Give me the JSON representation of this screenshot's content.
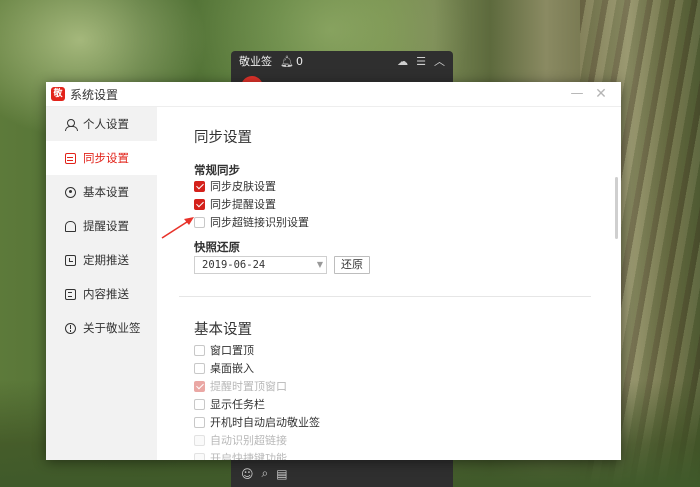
{
  "background_widget": {
    "title": "敬业签",
    "bell_count": "0"
  },
  "dialog": {
    "title": "系统设置",
    "logo_text": "敬",
    "minimize_symbol": "—",
    "close_symbol": "✕"
  },
  "sidebar": {
    "items": [
      {
        "label": "个人设置",
        "icon": "user-icon"
      },
      {
        "label": "同步设置",
        "icon": "sync-icon",
        "active": true
      },
      {
        "label": "基本设置",
        "icon": "gear-icon"
      },
      {
        "label": "提醒设置",
        "icon": "bell-icon"
      },
      {
        "label": "定期推送",
        "icon": "clock-icon"
      },
      {
        "label": "内容推送",
        "icon": "doc-icon"
      },
      {
        "label": "关于敬业签",
        "icon": "info-icon"
      }
    ]
  },
  "sync": {
    "title": "同步设置",
    "general_title": "常规同步",
    "options": [
      {
        "label": "同步皮肤设置",
        "checked": true
      },
      {
        "label": "同步提醒设置",
        "checked": true
      },
      {
        "label": "同步超链接识别设置",
        "checked": false
      }
    ],
    "snapshot_title": "快照还原",
    "snapshot_date": "2019-06-24",
    "restore_label": "还原"
  },
  "basic": {
    "title": "基本设置",
    "options": [
      {
        "label": "窗口置顶",
        "state": "unchecked"
      },
      {
        "label": "桌面嵌入",
        "state": "unchecked"
      },
      {
        "label": "提醒时置顶窗口",
        "state": "checked-disabled"
      },
      {
        "label": "显示任务栏",
        "state": "unchecked"
      },
      {
        "label": "开机时自动启动敬业签",
        "state": "unchecked"
      },
      {
        "label": "自动识别超链接",
        "state": "disabled"
      },
      {
        "label": "开启快捷键功能",
        "state": "disabled"
      }
    ]
  },
  "colors": {
    "accent": "#e2231a",
    "checkbox_checked": "#d4211b"
  }
}
